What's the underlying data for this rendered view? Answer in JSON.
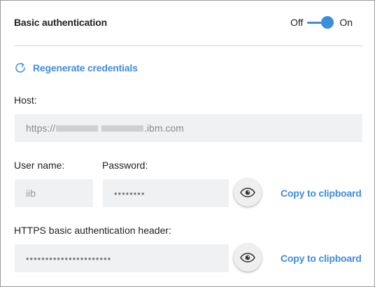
{
  "header": {
    "title": "Basic authentication",
    "toggle_off_label": "Off",
    "toggle_on_label": "On",
    "toggle_state": "on"
  },
  "regenerate": {
    "label": "Regenerate credentials",
    "icon": "refresh-icon"
  },
  "host": {
    "label": "Host:",
    "value_prefix": "https://",
    "value_suffix": ".ibm.com"
  },
  "user": {
    "label": "User name:",
    "value": "iib"
  },
  "password": {
    "label": "Password:",
    "value": "••••••••",
    "reveal_icon": "eye-icon",
    "copy_label": "Copy to clipboard"
  },
  "https_header": {
    "label": "HTTPS basic authentication header:",
    "value": "••••••••••••••••••••••",
    "reveal_icon": "eye-icon",
    "copy_label": "Copy to clipboard"
  },
  "colors": {
    "accent": "#3e8ddd",
    "field_bg": "#f0f1f2",
    "divider": "#dadada"
  }
}
